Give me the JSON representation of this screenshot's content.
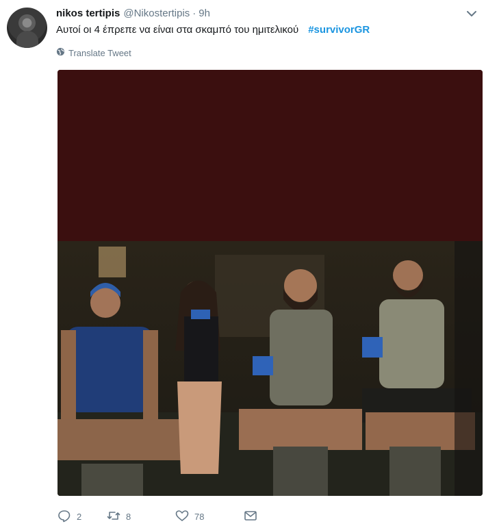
{
  "tweet": {
    "author_name": "nikos tertipis",
    "handle": "@Nikostertipis",
    "separator": "·",
    "time": "9h",
    "text": "Αυτοί οι 4 έπρεπε να είναι στα σκαμπό του ημιτελικού",
    "hashtag": "#survivorGR",
    "translate_label": "Translate Tweet"
  },
  "actions": {
    "replies": "2",
    "retweets": "8",
    "likes": "78"
  },
  "colors": {
    "hashtag": "#1b95e0",
    "muted": "#657786",
    "media_top": "#3b0f0f"
  },
  "icons": [
    "avatar",
    "chevron-down-icon",
    "globe-icon",
    "reply-icon",
    "retweet-icon",
    "like-icon",
    "dm-icon"
  ]
}
